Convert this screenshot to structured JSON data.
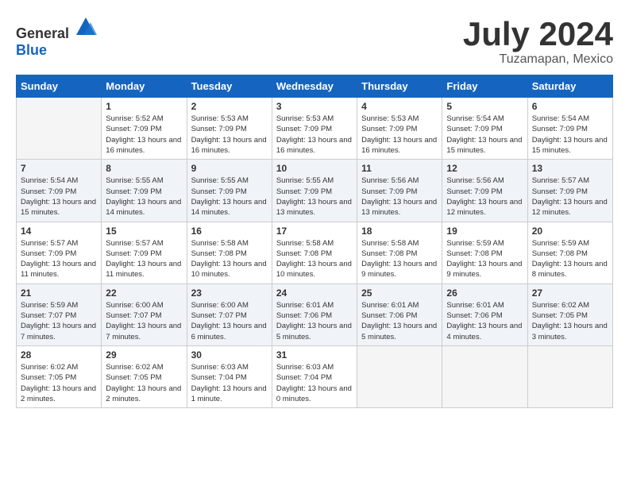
{
  "header": {
    "logo_general": "General",
    "logo_blue": "Blue",
    "title": "July 2024",
    "subtitle": "Tuzamapan, Mexico"
  },
  "weekdays": [
    "Sunday",
    "Monday",
    "Tuesday",
    "Wednesday",
    "Thursday",
    "Friday",
    "Saturday"
  ],
  "weeks": [
    [
      {
        "day": "",
        "empty": true
      },
      {
        "day": "1",
        "sunrise": "5:52 AM",
        "sunset": "7:09 PM",
        "daylight": "13 hours and 16 minutes."
      },
      {
        "day": "2",
        "sunrise": "5:53 AM",
        "sunset": "7:09 PM",
        "daylight": "13 hours and 16 minutes."
      },
      {
        "day": "3",
        "sunrise": "5:53 AM",
        "sunset": "7:09 PM",
        "daylight": "13 hours and 16 minutes."
      },
      {
        "day": "4",
        "sunrise": "5:53 AM",
        "sunset": "7:09 PM",
        "daylight": "13 hours and 16 minutes."
      },
      {
        "day": "5",
        "sunrise": "5:54 AM",
        "sunset": "7:09 PM",
        "daylight": "13 hours and 15 minutes."
      },
      {
        "day": "6",
        "sunrise": "5:54 AM",
        "sunset": "7:09 PM",
        "daylight": "13 hours and 15 minutes."
      }
    ],
    [
      {
        "day": "7",
        "sunrise": "5:54 AM",
        "sunset": "7:09 PM",
        "daylight": "13 hours and 15 minutes."
      },
      {
        "day": "8",
        "sunrise": "5:55 AM",
        "sunset": "7:09 PM",
        "daylight": "13 hours and 14 minutes."
      },
      {
        "day": "9",
        "sunrise": "5:55 AM",
        "sunset": "7:09 PM",
        "daylight": "13 hours and 14 minutes."
      },
      {
        "day": "10",
        "sunrise": "5:55 AM",
        "sunset": "7:09 PM",
        "daylight": "13 hours and 13 minutes."
      },
      {
        "day": "11",
        "sunrise": "5:56 AM",
        "sunset": "7:09 PM",
        "daylight": "13 hours and 13 minutes."
      },
      {
        "day": "12",
        "sunrise": "5:56 AM",
        "sunset": "7:09 PM",
        "daylight": "13 hours and 12 minutes."
      },
      {
        "day": "13",
        "sunrise": "5:57 AM",
        "sunset": "7:09 PM",
        "daylight": "13 hours and 12 minutes."
      }
    ],
    [
      {
        "day": "14",
        "sunrise": "5:57 AM",
        "sunset": "7:09 PM",
        "daylight": "13 hours and 11 minutes."
      },
      {
        "day": "15",
        "sunrise": "5:57 AM",
        "sunset": "7:09 PM",
        "daylight": "13 hours and 11 minutes."
      },
      {
        "day": "16",
        "sunrise": "5:58 AM",
        "sunset": "7:08 PM",
        "daylight": "13 hours and 10 minutes."
      },
      {
        "day": "17",
        "sunrise": "5:58 AM",
        "sunset": "7:08 PM",
        "daylight": "13 hours and 10 minutes."
      },
      {
        "day": "18",
        "sunrise": "5:58 AM",
        "sunset": "7:08 PM",
        "daylight": "13 hours and 9 minutes."
      },
      {
        "day": "19",
        "sunrise": "5:59 AM",
        "sunset": "7:08 PM",
        "daylight": "13 hours and 9 minutes."
      },
      {
        "day": "20",
        "sunrise": "5:59 AM",
        "sunset": "7:08 PM",
        "daylight": "13 hours and 8 minutes."
      }
    ],
    [
      {
        "day": "21",
        "sunrise": "5:59 AM",
        "sunset": "7:07 PM",
        "daylight": "13 hours and 7 minutes."
      },
      {
        "day": "22",
        "sunrise": "6:00 AM",
        "sunset": "7:07 PM",
        "daylight": "13 hours and 7 minutes."
      },
      {
        "day": "23",
        "sunrise": "6:00 AM",
        "sunset": "7:07 PM",
        "daylight": "13 hours and 6 minutes."
      },
      {
        "day": "24",
        "sunrise": "6:01 AM",
        "sunset": "7:06 PM",
        "daylight": "13 hours and 5 minutes."
      },
      {
        "day": "25",
        "sunrise": "6:01 AM",
        "sunset": "7:06 PM",
        "daylight": "13 hours and 5 minutes."
      },
      {
        "day": "26",
        "sunrise": "6:01 AM",
        "sunset": "7:06 PM",
        "daylight": "13 hours and 4 minutes."
      },
      {
        "day": "27",
        "sunrise": "6:02 AM",
        "sunset": "7:05 PM",
        "daylight": "13 hours and 3 minutes."
      }
    ],
    [
      {
        "day": "28",
        "sunrise": "6:02 AM",
        "sunset": "7:05 PM",
        "daylight": "13 hours and 2 minutes."
      },
      {
        "day": "29",
        "sunrise": "6:02 AM",
        "sunset": "7:05 PM",
        "daylight": "13 hours and 2 minutes."
      },
      {
        "day": "30",
        "sunrise": "6:03 AM",
        "sunset": "7:04 PM",
        "daylight": "13 hours and 1 minute."
      },
      {
        "day": "31",
        "sunrise": "6:03 AM",
        "sunset": "7:04 PM",
        "daylight": "13 hours and 0 minutes."
      },
      {
        "day": "",
        "empty": true
      },
      {
        "day": "",
        "empty": true
      },
      {
        "day": "",
        "empty": true
      }
    ]
  ]
}
